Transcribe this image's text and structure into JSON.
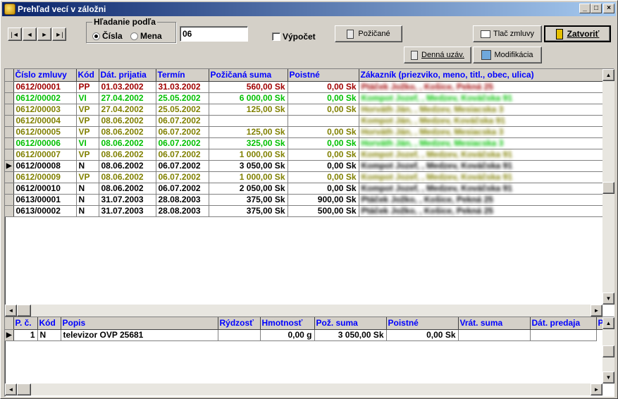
{
  "window": {
    "title": "Prehľad vecí v záložni",
    "min": "_",
    "max": "□",
    "close": "×"
  },
  "nav": [
    "|◄",
    "◄",
    "►",
    "►|"
  ],
  "search": {
    "legend": "Hľadanie podľa",
    "opt1": "Čísla",
    "opt2": "Mena",
    "value": "06"
  },
  "calc_label": "Výpočet",
  "buttons": {
    "borrowed": "Požičané",
    "print": "Tlač zmluvy",
    "close": "Zatvoriť",
    "daily": "Denná uzáv.",
    "modify": "Modifikácia"
  },
  "colors": {
    "red": "#a00000",
    "green": "#00c000",
    "olive": "#808000",
    "black": "#000000"
  },
  "contracts": {
    "headers": [
      "Číslo zmluvy",
      "Kód",
      "Dát. prijatia",
      "Termín",
      "Požičaná suma",
      "Poistné",
      "Zákazník (priezviko, meno, titl., obec, ulica)"
    ],
    "rows": [
      {
        "c": [
          "0612/00001",
          "PP",
          "01.03.2002",
          "31.03.2002",
          "560,00 Sk",
          "0,00 Sk",
          "Ptáček Jožko, , Košice, Pekná 25"
        ],
        "color": "red"
      },
      {
        "c": [
          "0612/00002",
          "VI",
          "27.04.2002",
          "25.05.2002",
          "6 000,00 Sk",
          "0,00 Sk",
          "Kompot Jozef, , Medzev, Kováčska 91"
        ],
        "color": "green"
      },
      {
        "c": [
          "0612/00003",
          "VP",
          "27.04.2002",
          "25.05.2002",
          "125,00 Sk",
          "0,00 Sk",
          "Horváth Ján, , Medzev, Mesiacska 3"
        ],
        "color": "olive"
      },
      {
        "c": [
          "0612/00004",
          "VP",
          "08.06.2002",
          "06.07.2002",
          "",
          "",
          "Kompot Ján, , Medzev, Kováčska 91"
        ],
        "color": "olive"
      },
      {
        "c": [
          "0612/00005",
          "VP",
          "08.06.2002",
          "06.07.2002",
          "125,00 Sk",
          "0,00 Sk",
          "Horváth Ján, , Medzev, Mesiacska 3"
        ],
        "color": "olive"
      },
      {
        "c": [
          "0612/00006",
          "VI",
          "08.06.2002",
          "06.07.2002",
          "325,00 Sk",
          "0,00 Sk",
          "Horváth Ján, , Medzev, Mesiacska 3"
        ],
        "color": "green"
      },
      {
        "c": [
          "0612/00007",
          "VP",
          "08.06.2002",
          "06.07.2002",
          "1 000,00 Sk",
          "0,00 Sk",
          "Kompot Jozef, , Medzev, Kováčska 91"
        ],
        "color": "olive"
      },
      {
        "c": [
          "0612/00008",
          "N",
          "08.06.2002",
          "06.07.2002",
          "3 050,00 Sk",
          "0,00 Sk",
          "Kompot Jozef, , Medzev, Kováčska 91"
        ],
        "color": "black",
        "current": true
      },
      {
        "c": [
          "0612/00009",
          "VP",
          "08.06.2002",
          "06.07.2002",
          "1 000,00 Sk",
          "0,00 Sk",
          "Kompot Jozef, , Medzev, Kováčska 91"
        ],
        "color": "olive"
      },
      {
        "c": [
          "0612/00010",
          "N",
          "08.06.2002",
          "06.07.2002",
          "2 050,00 Sk",
          "0,00 Sk",
          "Kompot Jozef, , Medzev, Kováčska 91"
        ],
        "color": "black"
      },
      {
        "c": [
          "0613/00001",
          "N",
          "31.07.2003",
          "28.08.2003",
          "375,00 Sk",
          "900,00 Sk",
          "Ptáček Jožko, , Košice, Pekná 25"
        ],
        "color": "black"
      },
      {
        "c": [
          "0613/00002",
          "N",
          "31.07.2003",
          "28.08.2003",
          "375,00 Sk",
          "500,00 Sk",
          "Ptáček Jožko, , Košice, Pekná 25"
        ],
        "color": "black"
      }
    ]
  },
  "items": {
    "headers": [
      "P. č.",
      "Kód",
      "Popis",
      "Rýdzosť",
      "Hmotnosť",
      "Pož. suma",
      "Poistné",
      "Vrát. suma",
      "Dát. predaja",
      "P"
    ],
    "rows": [
      {
        "c": [
          "1",
          "N",
          "televizor OVP 25681",
          "",
          "0,00 g",
          "3 050,00 Sk",
          "0,00 Sk",
          "",
          ""
        ]
      }
    ]
  }
}
